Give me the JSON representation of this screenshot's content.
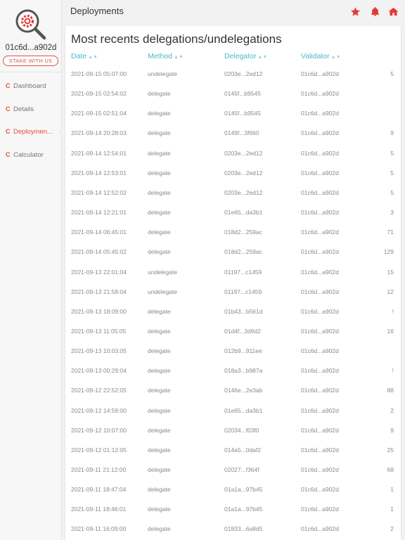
{
  "sidebar": {
    "address": "01c6d...a902d",
    "stake_label": "STAKE WITH US",
    "nav": [
      {
        "label": "Dashboard",
        "icon": "cspr-icon",
        "active": false
      },
      {
        "label": "Details",
        "icon": "cspr-icon",
        "active": false
      },
      {
        "label": "Deploymen...",
        "icon": "cspr-icon",
        "active": true
      },
      {
        "label": "Calculator",
        "icon": "cspr-icon",
        "active": false
      }
    ]
  },
  "header": {
    "title": "Deployments",
    "icons": [
      "star-icon",
      "bell-icon",
      "home-icon"
    ],
    "accent": "#e53935"
  },
  "main": {
    "title": "Most recents delegations/undelegations",
    "columns": [
      "Date",
      "Method",
      "Delegator",
      "Validator"
    ],
    "rows": [
      {
        "date": "2021-09-15 05:07:00",
        "method": "undelegate",
        "delegator": "0203e...2ed12",
        "validator": "01c6d...a902d",
        "amount": "5"
      },
      {
        "date": "2021-09-15 02:54:02",
        "method": "delegate",
        "delegator": "0145f...b9545",
        "validator": "01c6d...a902d",
        "amount": ""
      },
      {
        "date": "2021-09-15 02:51:04",
        "method": "delegate",
        "delegator": "0145f...b9545",
        "validator": "01c6d...a902d",
        "amount": ""
      },
      {
        "date": "2021-09-14 20:28:03",
        "method": "delegate",
        "delegator": "0149f...3f660",
        "validator": "01c6d...a902d",
        "amount": "9"
      },
      {
        "date": "2021-09-14 12:54:01",
        "method": "delegate",
        "delegator": "0203e...2ed12",
        "validator": "01c6d...a902d",
        "amount": "5"
      },
      {
        "date": "2021-09-14 12:53:01",
        "method": "delegate",
        "delegator": "0203e...2ed12",
        "validator": "01c6d...a902d",
        "amount": "5"
      },
      {
        "date": "2021-09-14 12:52:02",
        "method": "delegate",
        "delegator": "0203e...2ed12",
        "validator": "01c6d...a902d",
        "amount": "5"
      },
      {
        "date": "2021-09-14 12:21:01",
        "method": "delegate",
        "delegator": "01e65...da3b1",
        "validator": "01c6d...a902d",
        "amount": "3"
      },
      {
        "date": "2021-09-14 06:45:01",
        "method": "delegate",
        "delegator": "018d2...259ac",
        "validator": "01c6d...a902d",
        "amount": "71"
      },
      {
        "date": "2021-09-14 05:45:02",
        "method": "delegate",
        "delegator": "018d2...259ac",
        "validator": "01c6d...a902d",
        "amount": "129"
      },
      {
        "date": "2021-09-13 22:01:04",
        "method": "undelegate",
        "delegator": "01197...c1459",
        "validator": "01c6d...a902d",
        "amount": "15"
      },
      {
        "date": "2021-09-13 21:58:04",
        "method": "undelegate",
        "delegator": "01197...c1459",
        "validator": "01c6d...a902d",
        "amount": "12"
      },
      {
        "date": "2021-09-13 18:09:00",
        "method": "delegate",
        "delegator": "01b43...b561d",
        "validator": "01c6d...a902d",
        "amount": "!"
      },
      {
        "date": "2021-09-13 11:05:05",
        "method": "delegate",
        "delegator": "01d4f...3d9d2",
        "validator": "01c6d...a902d",
        "amount": "16"
      },
      {
        "date": "2021-09-13 10:03:05",
        "method": "delegate",
        "delegator": "012b9...911ee",
        "validator": "01c6d...a902d",
        "amount": ""
      },
      {
        "date": "2021-09-13 00:29:04",
        "method": "delegate",
        "delegator": "018a3...b987a",
        "validator": "01c6d...a902d",
        "amount": "!"
      },
      {
        "date": "2021-09-12 22:52:05",
        "method": "delegate",
        "delegator": "0146e...2e3ab",
        "validator": "01c6d...a902d",
        "amount": "88"
      },
      {
        "date": "2021-09-12 14:59:00",
        "method": "delegate",
        "delegator": "01e65...da3b1",
        "validator": "01c6d...a902d",
        "amount": "2"
      },
      {
        "date": "2021-09-12 10:07:00",
        "method": "delegate",
        "delegator": "02034...f03f0",
        "validator": "01c6d...a902d",
        "amount": "9"
      },
      {
        "date": "2021-09-12 01:12:05",
        "method": "delegate",
        "delegator": "014a5...0daf2",
        "validator": "01c6d...a902d",
        "amount": "25"
      },
      {
        "date": "2021-09-11 21:12:00",
        "method": "delegate",
        "delegator": "02027...f364f",
        "validator": "01c6d...a902d",
        "amount": "68"
      },
      {
        "date": "2021-09-11 18:47:04",
        "method": "delegate",
        "delegator": "01a1a...97b45",
        "validator": "01c6d...a902d",
        "amount": "1"
      },
      {
        "date": "2021-09-11 18:46:01",
        "method": "delegate",
        "delegator": "01a1a...97b45",
        "validator": "01c6d...a902d",
        "amount": "1"
      },
      {
        "date": "2021-09-11 16:09:00",
        "method": "delegate",
        "delegator": "01833...6a8d5",
        "validator": "01c6d...a902d",
        "amount": "2"
      }
    ]
  }
}
